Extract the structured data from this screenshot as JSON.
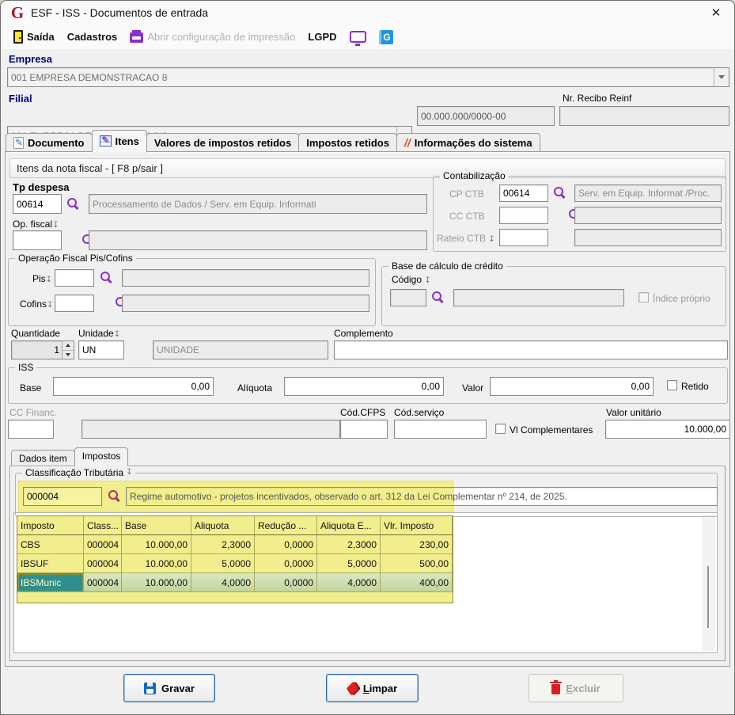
{
  "window": {
    "title": "ESF - ISS - Documentos de entrada"
  },
  "menubar": {
    "saida": "Saída",
    "cadastros": "Cadastros",
    "config_impressao": "Abrir configuração de impressão",
    "lgpd": "LGPD"
  },
  "header": {
    "empresa_label": "Empresa",
    "empresa_value": "001 EMPRESA DEMONSTRACAO 8",
    "filial_label": "Filial",
    "filial_value": "001 EMPRESA DEMONSTRACAO 8",
    "cnpj_value": "00.000.000/0000-00",
    "recibo_reinf_label": "Nr. Recibo Reinf",
    "recibo_reinf_value": ""
  },
  "tabs": {
    "labels": [
      "Documento",
      "Itens",
      "Valores de impostos retidos",
      "Impostos retidos",
      "Informações do sistema"
    ],
    "active": "Itens"
  },
  "itens": {
    "caption": "Itens da nota fiscal - [ F8 p/sair ]",
    "tp_despesa_label": "Tp despesa",
    "tp_despesa_code": "00614",
    "tp_despesa_desc": "Processamento de Dados / Serv. em Equip. Informati",
    "op_fiscal_label": "Op. fiscal",
    "op_fiscal_code": "",
    "op_fiscal_desc": "",
    "contab": {
      "title": "Contabilização",
      "cp_label": "CP CTB",
      "cp_code": "00614",
      "cp_desc": "Serv. em Equip. Informat /Proc.",
      "cc_label": "CC CTB",
      "cc_code": "",
      "cc_desc": "",
      "rateio_label": "Rateio CTB",
      "rateio_code": "",
      "rateio_desc": ""
    },
    "piscofins": {
      "title": "Operação Fiscal Pis/Cofins",
      "pis_label": "Pis",
      "pis_code": "",
      "pis_desc": "",
      "cofins_label": "Cofins",
      "cofins_code": "",
      "cofins_desc": ""
    },
    "base_credito": {
      "title": "Base de cálculo de crédito",
      "codigo_label": "Código",
      "codigo_code": "",
      "codigo_desc": "",
      "indice_proprio_label": "Índice próprio"
    },
    "quantidade_label": "Quantidade",
    "quantidade_value": "1",
    "unidade_label": "Unidade",
    "unidade_code": "UN",
    "unidade_desc": "UNIDADE",
    "complemento_label": "Complemento",
    "complemento_value": "",
    "iss": {
      "title": "ISS",
      "base_label": "Base",
      "base_value": "0,00",
      "aliquota_label": "Alíquota",
      "aliquota_value": "0,00",
      "valor_label": "Valor",
      "valor_value": "0,00",
      "retido_label": "Retido"
    },
    "cc_financ_label": "CC Financ.",
    "cc_financ_code": "",
    "cc_financ_desc": "",
    "cod_cfps_label": "Cód.CFPS",
    "cod_cfps_value": "",
    "cod_servico_label": "Cód.serviço",
    "cod_servico_value": "",
    "vl_complementares_label": "Vl Complementares",
    "valor_unitario_label": "Valor unitário",
    "valor_unitario_value": "10.000,00"
  },
  "subtabs": {
    "labels": [
      "Dados item",
      "Impostos"
    ],
    "active": "Impostos"
  },
  "classificacao": {
    "title": "Classificação Tributária",
    "code": "000004",
    "desc": "Regime automotivo - projetos incentivados, observado o art. 312 da Lei Complementar nº 214, de 2025."
  },
  "grid": {
    "columns": [
      "Imposto",
      "Class...",
      "Base",
      "Aliquota",
      "Redução ...",
      "Aliquota E...",
      "Vlr. Imposto"
    ],
    "rows": [
      [
        "CBS",
        "000004",
        "10.000,00",
        "2,3000",
        "0,0000",
        "2,3000",
        "230,00"
      ],
      [
        "IBSUF",
        "000004",
        "10.000,00",
        "5,0000",
        "0,0000",
        "5,0000",
        "500,00"
      ],
      [
        "IBSMunic",
        "000004",
        "10.000,00",
        "4,0000",
        "0,0000",
        "4,0000",
        "400,00"
      ]
    ],
    "selected_row": 2
  },
  "buttons": {
    "gravar": "Gravar",
    "limpar": "Limpar",
    "excluir": "Excluir"
  },
  "colors": {
    "accent_purple": "#8b2fc9",
    "highlight_yellow": "#f2ee8d",
    "selected_teal": "#2f8e8e",
    "selected_row_green": "#cdddab",
    "label_navy": "#000080"
  }
}
